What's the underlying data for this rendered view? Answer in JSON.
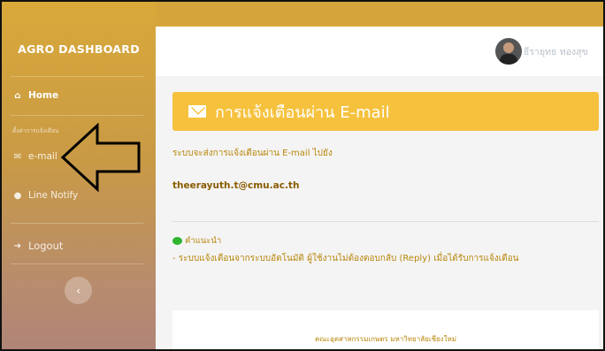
{
  "sidebar": {
    "brand": "AGRO DASHBOARD",
    "home_label": "Home",
    "section_label": "ตั้งค่าการแจ้งเตือน",
    "email_label": "e-mail",
    "line_label": "Line Notify",
    "logout_label": "Logout",
    "toggle_glyph": "‹"
  },
  "header": {
    "username": "ธีรายุทธ ทองสุข"
  },
  "main": {
    "banner_title": "การแจ้งเตือนผ่าน E-mail",
    "intro_text": "ระบบจะส่งการแจ้งเตือนผ่าน E-mail ไปยัง",
    "email_address": "theerayuth.t@cmu.ac.th",
    "tip_title": "คำแนะนำ",
    "tip_text": "- ระบบแจ้งเตือนจากระบบอัตโนมัติ ผู้ใช้งานไม่ต้องตอบกลับ (Reply) เมื่อได้รับการแจ้งเตือน"
  },
  "footer": {
    "text": "คณะอุตสาหกรรมเกษตร มหาวิทยาลัยเชียงใหม่"
  },
  "colors": {
    "banner": "#f6c23e",
    "sidebar_top": "#d9a93a",
    "sidebar_bottom": "#b08478",
    "accent_text": "#b8860b"
  },
  "icons": {
    "home": "home-icon",
    "email": "envelope-icon",
    "line": "chat-bubble-icon",
    "logout": "sign-out-icon"
  }
}
